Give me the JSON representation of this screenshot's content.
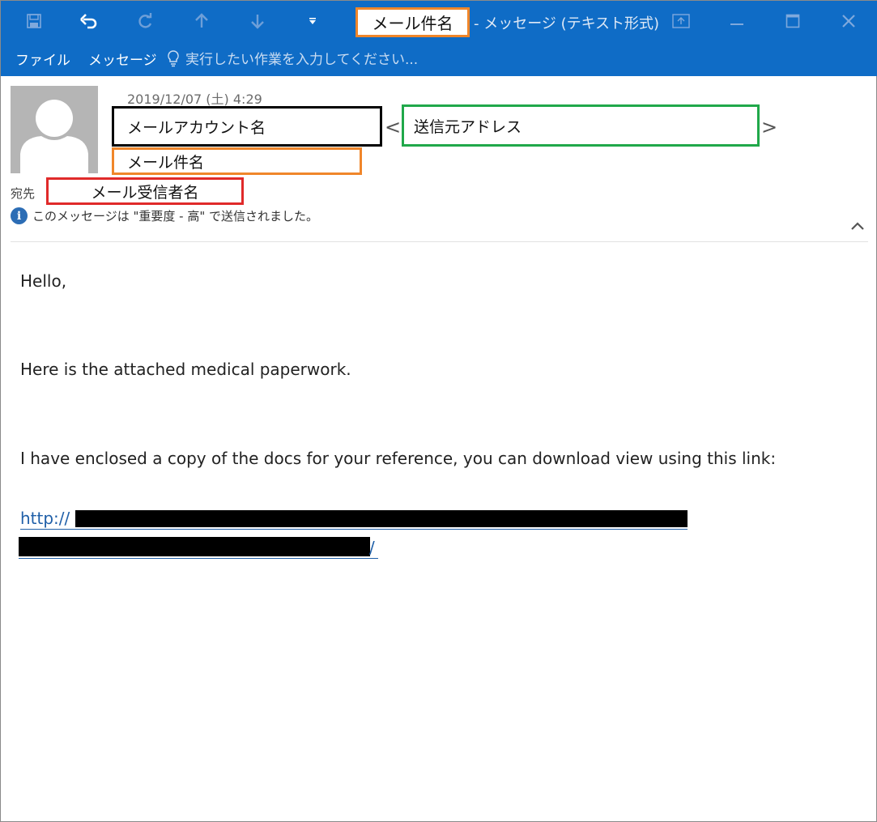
{
  "window": {
    "title_subject": "メール件名",
    "title_suffix": "- メッセージ (テキスト形式)",
    "quick_access_icons": [
      "save-icon",
      "undo-icon",
      "redo-icon",
      "up-arrow-icon",
      "down-arrow-icon",
      "customize-dropdown-icon"
    ],
    "controls": [
      "restore-ribbon-icon",
      "minimize-icon",
      "maximize-icon",
      "close-icon"
    ]
  },
  "ribbon": {
    "tabs": [
      {
        "label": "ファイル"
      },
      {
        "label": "メッセージ"
      }
    ],
    "tellme_placeholder": "実行したい作業を入力してください..."
  },
  "header": {
    "date": "2019/12/07 (土) 4:29",
    "account_name": "メールアカウント名",
    "bracket_open": "<",
    "bracket_close": ">",
    "sender_address": "送信元アドレス",
    "subject": "メール件名",
    "to_label": "宛先",
    "recipient": "メール受信者名",
    "importance_note": "このメッセージは \"重要度 - 高\" で送信されました。"
  },
  "body": {
    "line1": "Hello,",
    "line2": "Here is the attached medical paperwork.",
    "line3": "I have enclosed a copy of the docs for your reference, you can download view using this link:",
    "link_prefix": "http://",
    "link_suffix": "/"
  },
  "colors": {
    "titlebar": "#0f6cc6",
    "account_box_border": "#000000",
    "sender_box_border": "#20a84a",
    "subject_box_border": "#f0862a",
    "recipient_box_border": "#e02a2a",
    "link": "#1f5fa8"
  }
}
